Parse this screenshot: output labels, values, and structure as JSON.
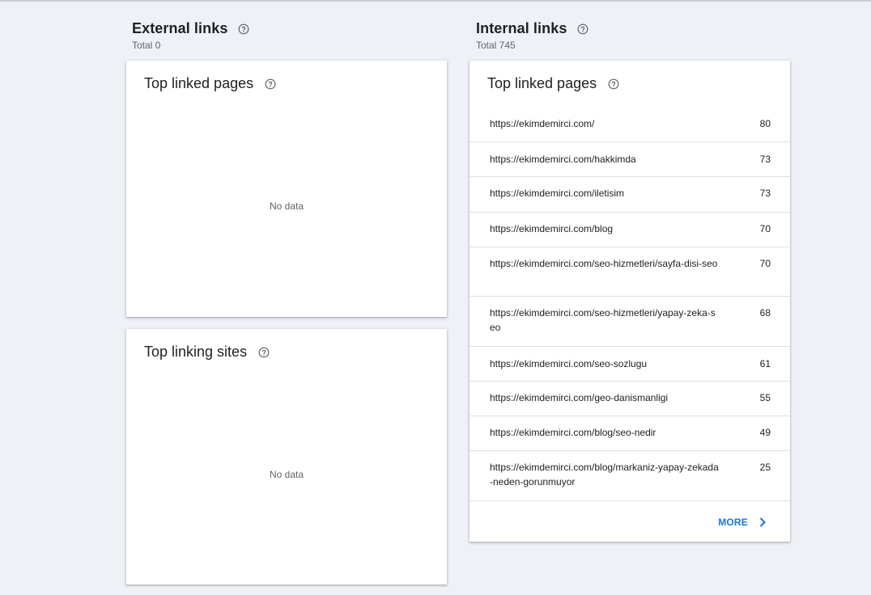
{
  "external": {
    "title": "External links",
    "total": "Total 0",
    "top_linked_pages": {
      "title": "Top linked pages",
      "empty": "No data"
    },
    "top_linking_sites": {
      "title": "Top linking sites",
      "empty": "No data"
    }
  },
  "internal": {
    "title": "Internal links",
    "total": "Total 745",
    "top_linked_pages": {
      "title": "Top linked pages",
      "rows": [
        {
          "url": "https://ekimdemirci.com/",
          "count": "80"
        },
        {
          "url": "https://ekimdemirci.com/hakkimda",
          "count": "73"
        },
        {
          "url": "https://ekimdemirci.com/iletisim",
          "count": "73"
        },
        {
          "url": "https://ekimdemirci.com/blog",
          "count": "70"
        },
        {
          "url": "https://ekimdemirci.com/seo-hizmetleri/sayfa-disi-seo",
          "count": "70"
        },
        {
          "url": "https://ekimdemirci.com/seo-hizmetleri/yapay-zeka-seo",
          "count": "68"
        },
        {
          "url": "https://ekimdemirci.com/seo-sozlugu",
          "count": "61"
        },
        {
          "url": "https://ekimdemirci.com/geo-danismanligi",
          "count": "55"
        },
        {
          "url": "https://ekimdemirci.com/blog/seo-nedir",
          "count": "49"
        },
        {
          "url": "https://ekimdemirci.com/blog/markaniz-yapay-zekada-neden-gorunmuyor",
          "count": "25"
        }
      ],
      "more_label": "MORE"
    }
  },
  "icons": {
    "help": "help-circle-icon",
    "more": "chevron-right-icon"
  },
  "colors": {
    "accent": "#1a73e8",
    "background": "#eef1f6"
  }
}
